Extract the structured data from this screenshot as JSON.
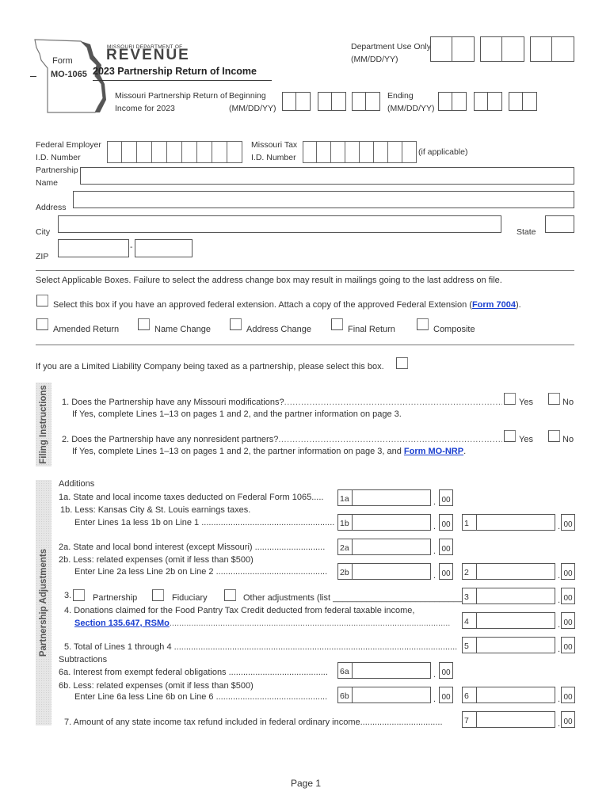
{
  "header": {
    "form_label": "Form",
    "form_number": "MO-1065",
    "agency_small": "MISSOURI DEPARTMENT OF",
    "agency_large": "REVENUE",
    "title": "2023 Partnership Return of Income",
    "subtitle_line1": "Missouri Partnership Return of",
    "subtitle_line2": "Income for 2023",
    "beginning_label": "Beginning",
    "beginning_format": "(MM/DD/YY)",
    "ending_label": "Ending",
    "ending_format": "(MM/DD/YY)",
    "dept_use_label": "Department Use Only",
    "dept_use_format": "(MM/DD/YY)"
  },
  "identity": {
    "fein_label_1": "Federal Employer",
    "fein_label_2": "I.D. Number",
    "mo_tax_label_1": "Missouri Tax",
    "mo_tax_label_2": "I.D. Number",
    "if_applicable": "(if applicable)",
    "partnership_label_1": "Partnership",
    "partnership_label_2": "Name",
    "address_label": "Address",
    "city_label": "City",
    "state_label": "State",
    "zip_label": "ZIP",
    "zip_dash": "-"
  },
  "boxes": {
    "instructions": "Select Applicable Boxes.  Failure to select the address change box may result in mailings going to the last address on file.",
    "extension_text": "Select this box if you have an approved federal extension.  Attach a copy of the approved Federal Extension (",
    "extension_link": "Form 7004",
    "extension_tail": ").",
    "options": [
      "Amended Return",
      "Name Change",
      "Address Change",
      "Final Return",
      "Composite"
    ],
    "llc_text": "If you are a Limited Liability Company being taxed as a partnership, please select this box."
  },
  "filing": {
    "section_label": "Filing Instructions",
    "q1": "1.  Does the Partnership have any Missouri modifications?",
    "q1_note": "If Yes, complete Lines 1–13 on pages 1 and 2, and the partner information on page 3.",
    "q2": "2.  Does the Partnership have any nonresident partners?",
    "q2_note": "If Yes, complete Lines 1–13 on pages 1 and 2, the partner information on page 3, and ",
    "q2_link": "Form MO-NRP",
    "q2_tail": ".",
    "yes": "Yes",
    "no": "No"
  },
  "adjustments": {
    "section_label": "Partnership Adjustments",
    "additions": "Additions",
    "l1a": "1a.  State and local income taxes deducted on Federal Form 1065.....",
    "l1b_1": "1b.  Less: Kansas City & St. Louis earnings taxes.",
    "l1b_2": "Enter Lines 1a less 1b on Line 1 .......................................................",
    "l2a": "2a.  State and local bond interest (except Missouri) .............................",
    "l2b_1": "2b.  Less: related expenses (omit if less than $500)",
    "l2b_2": "Enter Line 2a less Line 2b on Line 2 ..............................................",
    "l3_num": "3.",
    "l3_opts": [
      "Partnership",
      "Fiduciary",
      "Other adjustments (list ___________________________)"
    ],
    "l4_1": "4.  Donations claimed for the Food Pantry Tax Credit deducted from federal taxable income,",
    "l4_link": "Section 135.647, RSMo",
    "l4_dots": "....................................................................................................................",
    "l5": "5.  Total of Lines 1 through 4 ......................................................................................................................",
    "subtractions": "Subtractions",
    "l6a": "6a.  Interest from exempt federal obligations .........................................",
    "l6b_1": "6b.  Less: related expenses (omit if less than $500)",
    "l6b_2": "Enter Line 6a less Line 6b on Line 6 ..............................................",
    "l7": "7.  Amount of any state income tax refund included in federal ordinary income..................................",
    "tags": {
      "1a": "1a",
      "1b": "1b",
      "2a": "2a",
      "2b": "2b",
      "6a": "6a",
      "6b": "6b",
      "1": "1",
      "2": "2",
      "3": "3",
      "4": "4",
      "5": "5",
      "6": "6",
      "7": "7"
    },
    "cents": "00",
    "decimal": "."
  },
  "footer": {
    "page": "Page 1"
  }
}
